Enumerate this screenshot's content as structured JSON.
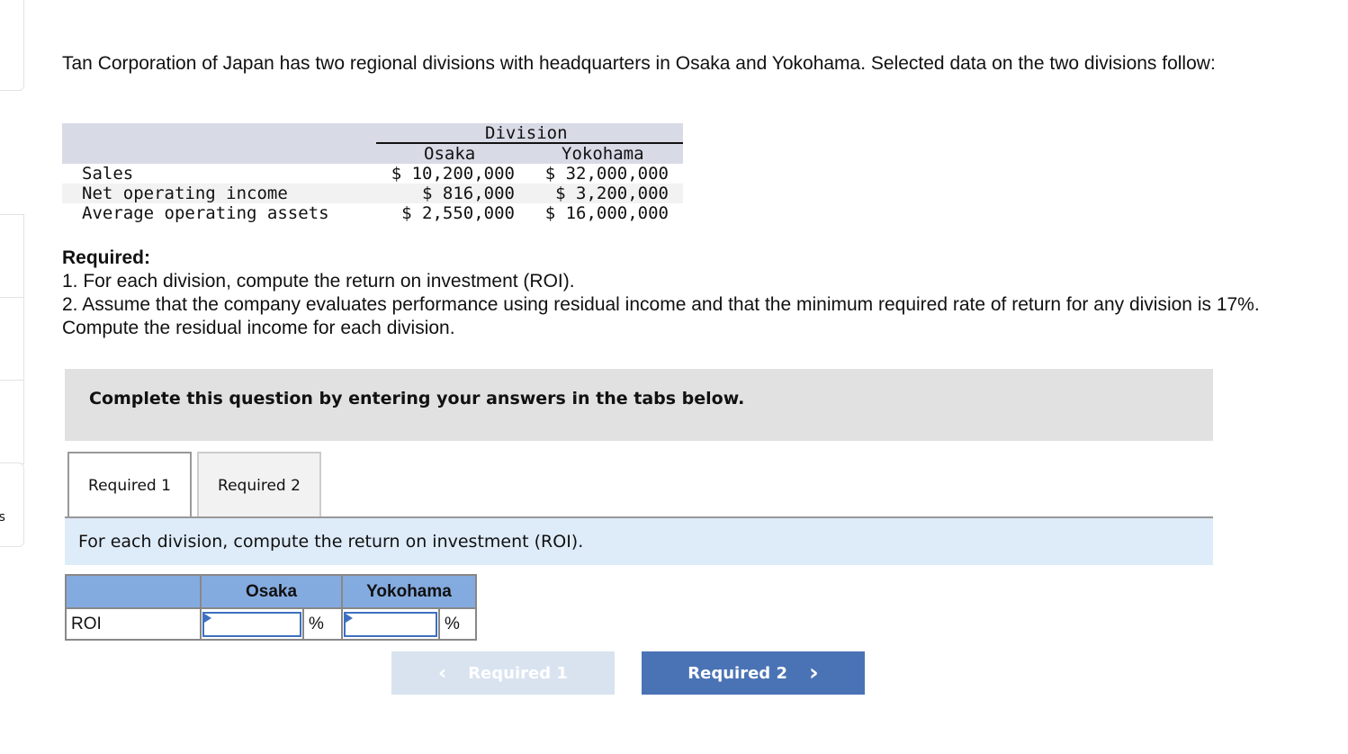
{
  "intro": "Tan Corporation of Japan has two regional divisions with headquarters in Osaka and Yokohama. Selected data on the two divisions follow:",
  "data_table": {
    "group_header": "Division",
    "columns": [
      "Osaka",
      "Yokohama"
    ],
    "rows": [
      {
        "label": "Sales",
        "osaka": "$ 10,200,000",
        "yokohama": "$ 32,000,000"
      },
      {
        "label": "Net operating income",
        "osaka": "$ 816,000",
        "yokohama": "$ 3,200,000"
      },
      {
        "label": "Average operating assets",
        "osaka": "$ 2,550,000",
        "yokohama": "$ 16,000,000"
      }
    ]
  },
  "required": {
    "heading": "Required:",
    "items": [
      "1. For each division, compute the return on investment (ROI).",
      "2. Assume that the company evaluates performance using residual income and that the minimum required rate of return for any division is 17%. Compute the residual income for each division."
    ]
  },
  "banner": "Complete this question by entering your answers in the tabs below.",
  "tabs": [
    {
      "label": "Required 1",
      "active": true
    },
    {
      "label": "Required 2",
      "active": false
    }
  ],
  "instruction": "For each division, compute the return on investment (ROI).",
  "answer_table": {
    "headers": [
      "",
      "Osaka",
      "Yokohama"
    ],
    "row_label": "ROI",
    "unit": "%",
    "osaka_value": "",
    "yokohama_value": ""
  },
  "nav": {
    "prev_label": "Required 1",
    "next_label": "Required 2",
    "prev_disabled": true
  },
  "sidebar_fragment": "es",
  "colors": {
    "header_blue": "#84abe0",
    "button_blue": "#4a73b5",
    "instruction_bg": "#deebf8"
  }
}
